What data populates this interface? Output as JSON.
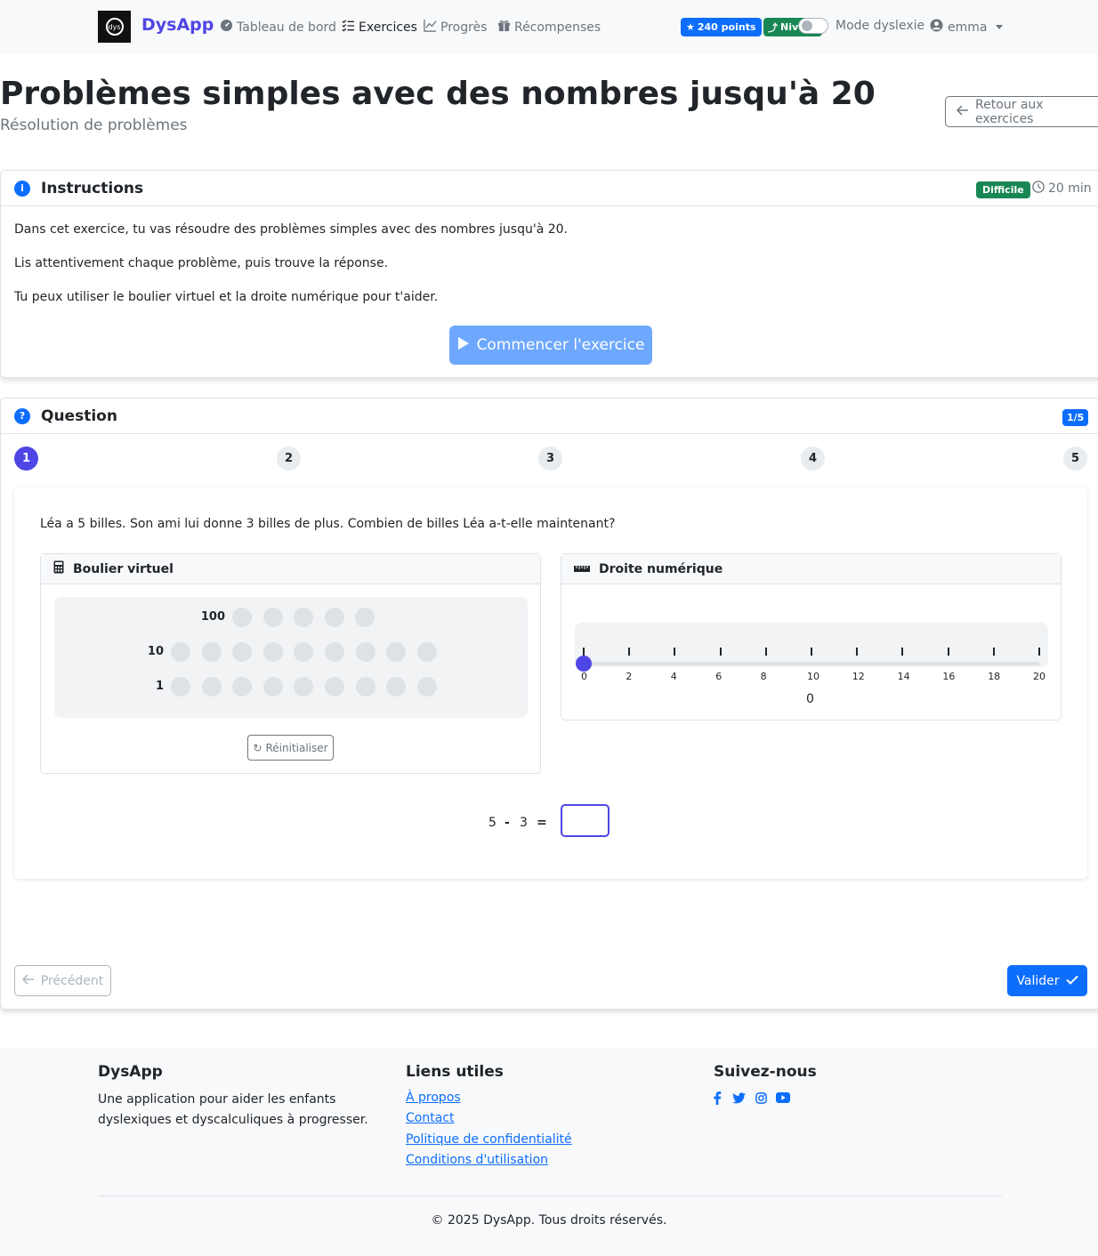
{
  "navbar": {
    "brand": "DysApp",
    "logo_text": "dys",
    "links": [
      {
        "label": "Tableau de bord"
      },
      {
        "label": "Exercices"
      },
      {
        "label": "Progrès"
      },
      {
        "label": "Récompenses"
      }
    ],
    "points_badge": "240 points",
    "level_badge": "Niveau",
    "dyslexia_mode_label": "Mode dyslexie",
    "user_name": "emma"
  },
  "header": {
    "title": "Problèmes simples avec des nombres jusqu'à 20",
    "subtitle": "Résolution de problèmes",
    "back_button": "Retour aux exercices"
  },
  "instructions": {
    "title": "Instructions",
    "difficulty": "Difficile",
    "duration": "20 min",
    "paragraphs": [
      "Dans cet exercice, tu vas résoudre des problèmes simples avec des nombres jusqu'à 20.",
      "Lis attentivement chaque problème, puis trouve la réponse.",
      "Tu peux utiliser le boulier virtuel et la droite numérique pour t'aider."
    ],
    "start_button": "Commencer l'exercice"
  },
  "question": {
    "title": "Question",
    "counter": "1/5",
    "steps": [
      "1",
      "2",
      "3",
      "4",
      "5"
    ],
    "active_step": 1,
    "text": "Léa a 5 billes. Son ami lui donne 3 billes de plus. Combien de billes Léa a-t-elle maintenant?",
    "abacus": {
      "title": "Boulier virtuel",
      "rows": [
        {
          "label": "100",
          "beads": 5
        },
        {
          "label": "10",
          "beads": 9
        },
        {
          "label": "1",
          "beads": 9
        }
      ],
      "reset_button": "Réinitialiser"
    },
    "number_line": {
      "title": "Droite numérique",
      "labels": [
        "0",
        "2",
        "4",
        "6",
        "8",
        "10",
        "12",
        "14",
        "16",
        "18",
        "20"
      ],
      "min": 0,
      "max": 20,
      "current_value": "0"
    },
    "equation": {
      "left": "5",
      "operator": "-",
      "right": "3",
      "equals": "=",
      "answer": ""
    },
    "prev_button": "Précédent",
    "validate_button": "Valider"
  },
  "footer": {
    "brand_title": "DysApp",
    "brand_desc": "Une application pour aider les enfants dyslexiques et dyscalculiques à progresser.",
    "links_title": "Liens utiles",
    "links": [
      "À propos",
      "Contact",
      "Politique de confidentialité",
      "Conditions d'utilisation"
    ],
    "social_title": "Suivez-nous",
    "social": [
      "facebook-icon",
      "twitter-icon",
      "instagram-icon",
      "youtube-icon"
    ],
    "copyright": "© 2025 DysApp. Tous droits réservés."
  },
  "colors": {
    "primary": "#0d6efd",
    "accent": "#4f46e5",
    "success": "#198754",
    "start_button": "#6ea8fe"
  }
}
